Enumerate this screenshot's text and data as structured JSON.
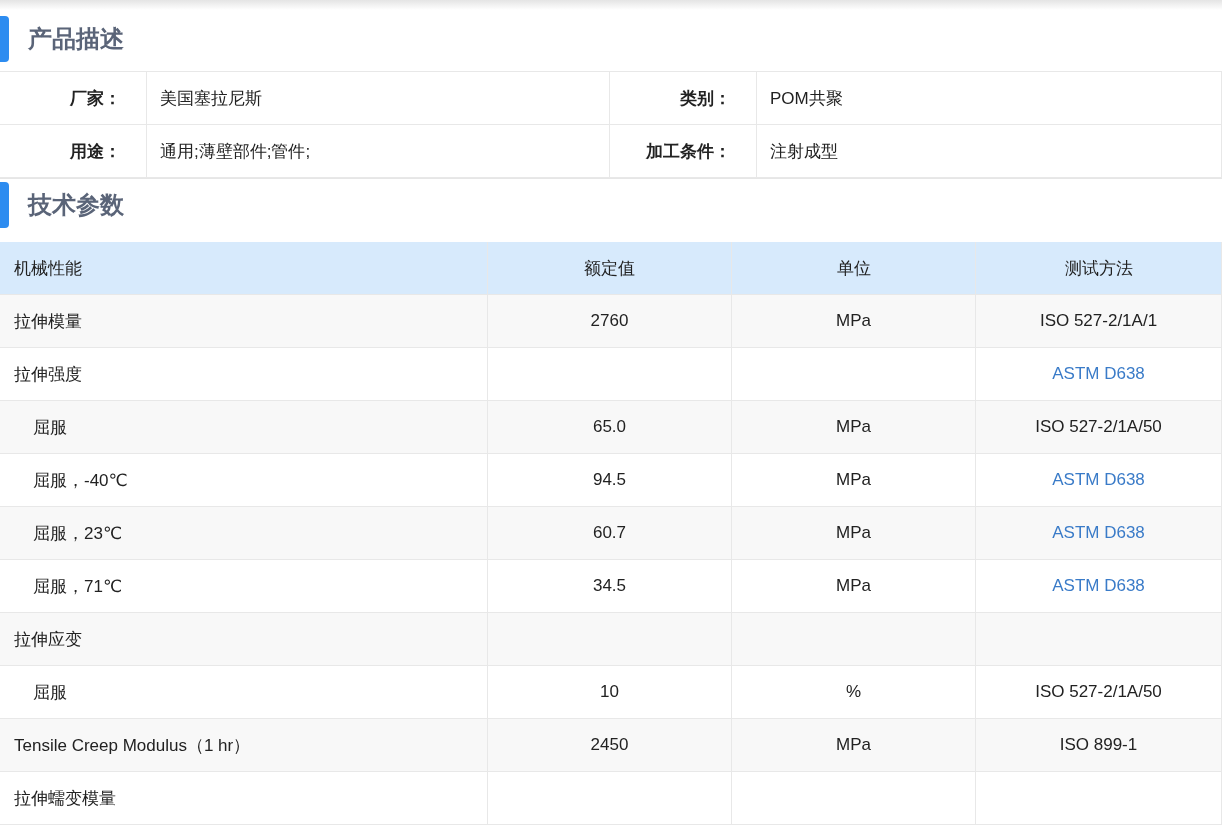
{
  "description": {
    "title": "产品描述",
    "rows": [
      [
        {
          "label": "厂家：",
          "value": "美国塞拉尼斯"
        },
        {
          "label": "类别：",
          "value": "POM共聚"
        }
      ],
      [
        {
          "label": "用途：",
          "value": "通用;薄壁部件;管件;"
        },
        {
          "label": "加工条件：",
          "value": "注射成型"
        }
      ]
    ]
  },
  "parameters": {
    "title": "技术参数",
    "columns": [
      "机械性能",
      "额定值",
      "单位",
      "测试方法"
    ],
    "rows": [
      {
        "property": "拉伸模量",
        "value": "2760",
        "unit": "MPa",
        "method": "ISO 527-2/1A/1",
        "method_link": false
      },
      {
        "property": "拉伸强度",
        "method": "ASTM D638",
        "method_link": true,
        "children": [
          {
            "property": "屈服",
            "value": "65.0",
            "unit": "MPa",
            "method": "ISO 527-2/1A/50",
            "method_link": false
          },
          {
            "property": "屈服，-40℃",
            "value": "94.5",
            "unit": "MPa",
            "method": "ASTM D638",
            "method_link": true
          },
          {
            "property": "屈服，23℃",
            "value": "60.7",
            "unit": "MPa",
            "method": "ASTM D638",
            "method_link": true
          },
          {
            "property": "屈服，71℃",
            "value": "34.5",
            "unit": "MPa",
            "method": "ASTM D638",
            "method_link": true
          }
        ]
      },
      {
        "property": "拉伸应变",
        "children": [
          {
            "property": "屈服",
            "value": "10",
            "unit": "%",
            "method": "ISO 527-2/1A/50",
            "method_link": false
          }
        ]
      },
      {
        "property": "Tensile Creep Modulus（1 hr）",
        "value": "2450",
        "unit": "MPa",
        "method": "ISO 899-1",
        "method_link": false
      },
      {
        "property": "拉伸蠕变模量"
      }
    ]
  }
}
